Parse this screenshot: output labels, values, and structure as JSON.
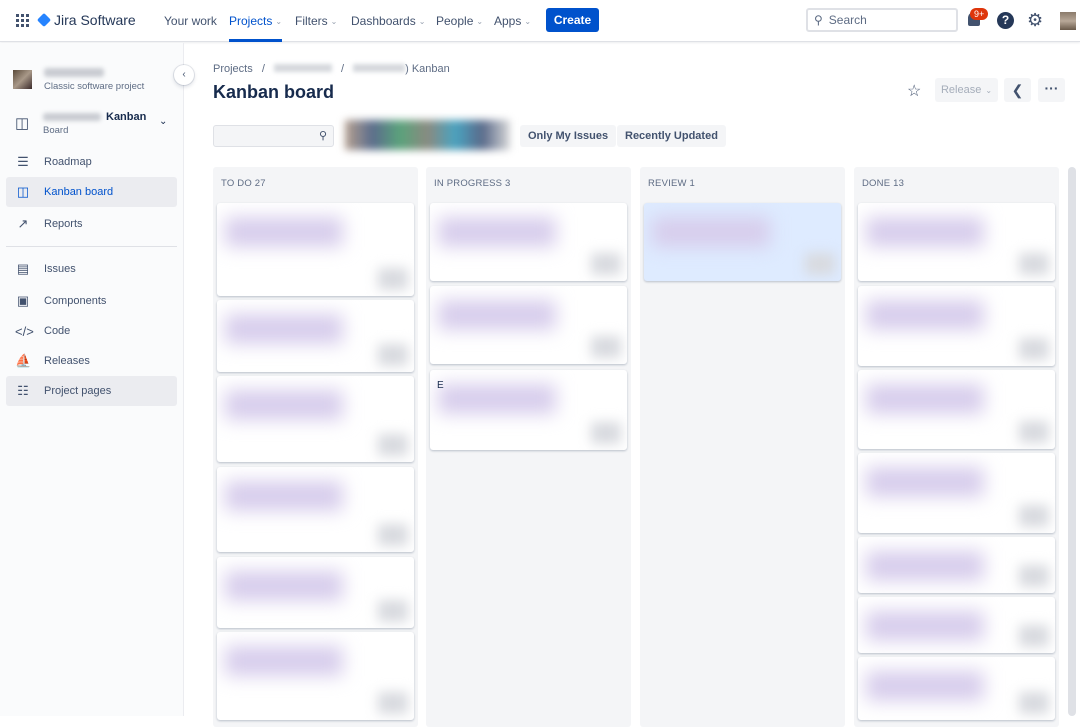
{
  "topbar": {
    "app_name": "Jira Software",
    "nav": [
      {
        "label": "Your work",
        "dropdown": false
      },
      {
        "label": "Projects",
        "dropdown": true,
        "active": true
      },
      {
        "label": "Filters",
        "dropdown": true
      },
      {
        "label": "Dashboards",
        "dropdown": true
      },
      {
        "label": "People",
        "dropdown": true
      },
      {
        "label": "Apps",
        "dropdown": true
      }
    ],
    "create_label": "Create",
    "search_placeholder": "Search",
    "notification_count": "9+",
    "help": "?"
  },
  "sidebar": {
    "project_type": "Classic software project",
    "board_name_suffix": "Kanban",
    "board_label": "Board",
    "items": [
      {
        "label": "Roadmap",
        "icon": "roadmap-icon"
      },
      {
        "label": "Kanban board",
        "icon": "board-icon",
        "selected": true
      },
      {
        "label": "Reports",
        "icon": "chart-icon"
      },
      {
        "label": "Issues",
        "icon": "issues-icon"
      },
      {
        "label": "Components",
        "icon": "components-icon"
      },
      {
        "label": "Code",
        "icon": "code-icon"
      },
      {
        "label": "Releases",
        "icon": "ship-icon"
      },
      {
        "label": "Project pages",
        "icon": "page-icon"
      }
    ]
  },
  "header": {
    "breadcrumb_root": "Projects",
    "breadcrumb_sep": "/",
    "breadcrumb_board_suffix": ") Kanban",
    "title": "Kanban board",
    "release_label": "Release"
  },
  "filters": {
    "quick": [
      "Only My Issues",
      "Recently Updated"
    ]
  },
  "columns": [
    {
      "title": "TO DO",
      "count": "27"
    },
    {
      "title": "IN PROGRESS",
      "count": "3"
    },
    {
      "title": "REVIEW",
      "count": "1"
    },
    {
      "title": "DONE",
      "count": "13"
    }
  ],
  "partial_card_text": "E",
  "colors": {
    "brand": "#0052cc",
    "badge": "#de350b"
  }
}
